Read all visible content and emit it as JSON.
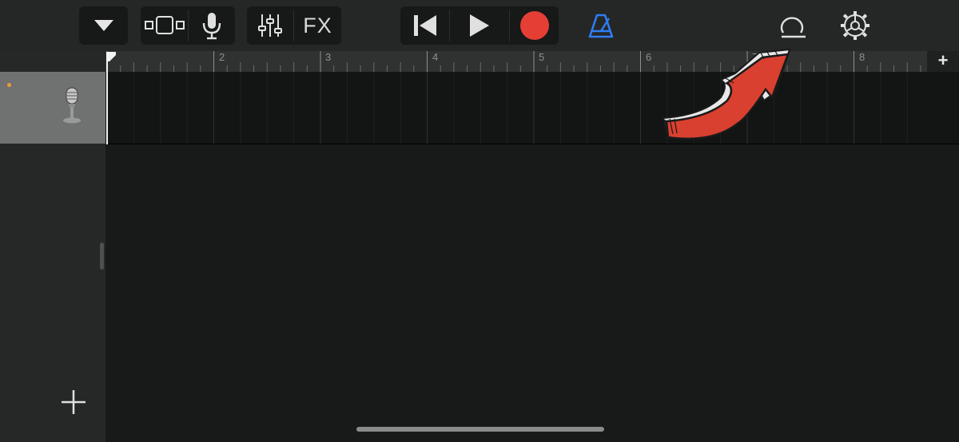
{
  "toolbar": {
    "fx_label": "FX"
  },
  "ruler": {
    "bars": [
      "2",
      "3",
      "4",
      "5",
      "6",
      "7",
      "8"
    ],
    "add_section_label": "+"
  },
  "track": {
    "instrument": "microphone"
  },
  "icons": {
    "browser": "triangle-down-icon",
    "tracks_view": "tracks-view-icon",
    "mic": "microphone-icon",
    "mixer": "mixer-sliders-icon",
    "go_start": "go-to-beginning-icon",
    "play": "play-icon",
    "record": "record-icon",
    "metronome": "metronome-icon",
    "loop": "loop-browser-icon",
    "settings": "settings-gear-icon"
  },
  "colors": {
    "record": "#e53f35",
    "metronome": "#2f7df6",
    "track_dot": "#f09a36",
    "arrow": "#d9402f"
  }
}
